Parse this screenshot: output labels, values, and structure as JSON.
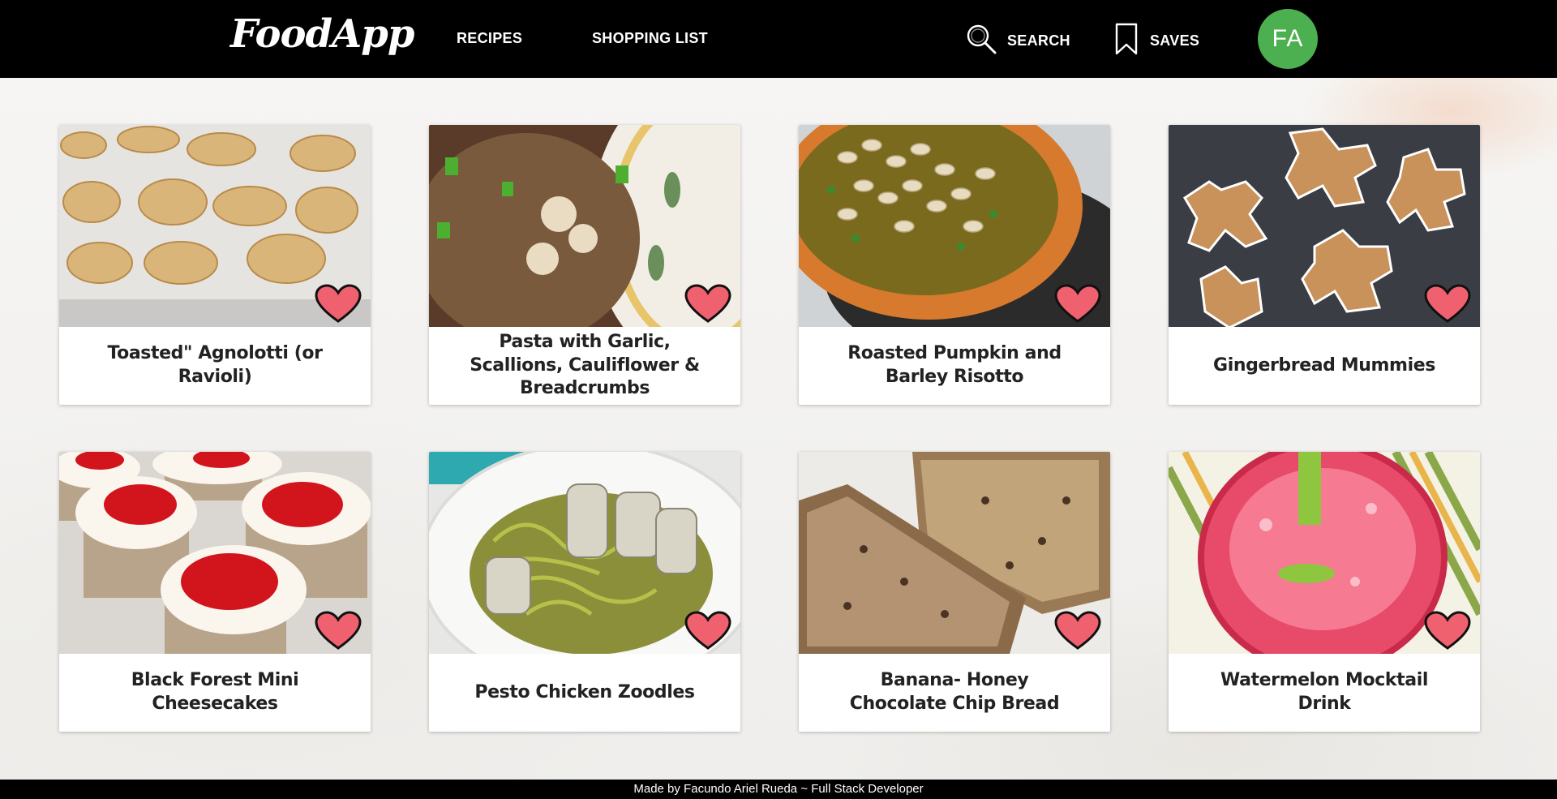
{
  "app": {
    "logo": "FoodApp"
  },
  "nav": {
    "recipes": "RECIPES",
    "shopping_list": "SHOPPING LIST",
    "search": "SEARCH",
    "saves": "SAVES",
    "avatar_initials": "FA"
  },
  "recipes": [
    {
      "title": "Toasted\" Agnolotti (or Ravioli)"
    },
    {
      "title": "Pasta with Garlic, Scallions, Cauliflower & Breadcrumbs"
    },
    {
      "title": "Roasted Pumpkin and Barley Risotto"
    },
    {
      "title": "Gingerbread Mummies"
    },
    {
      "title": "Black Forest Mini Cheesecakes"
    },
    {
      "title": "Pesto Chicken Zoodles"
    },
    {
      "title": "Banana- Honey Chocolate Chip Bread"
    },
    {
      "title": "Watermelon Mocktail Drink"
    }
  ],
  "footer": {
    "text": "Made by Facundo Ariel Rueda ~ Full Stack Developer"
  },
  "colors": {
    "navbar": "#000000",
    "avatar": "#4caf50",
    "heart": "#f06170"
  }
}
